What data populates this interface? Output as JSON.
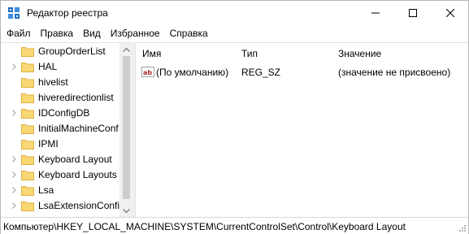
{
  "window": {
    "title": "Редактор реестра",
    "icon": "regedit-icon",
    "controls": [
      "minimize-icon",
      "maximize-icon",
      "close-icon"
    ]
  },
  "menu": [
    "Файл",
    "Правка",
    "Вид",
    "Избранное",
    "Справка"
  ],
  "tree": {
    "items": [
      {
        "label": "GroupOrderList",
        "expandable": false
      },
      {
        "label": "HAL",
        "expandable": true
      },
      {
        "label": "hivelist",
        "expandable": false
      },
      {
        "label": "hiveredirectionlist",
        "expandable": false
      },
      {
        "label": "IDConfigDB",
        "expandable": true
      },
      {
        "label": "InitialMachineConf",
        "expandable": false
      },
      {
        "label": "IPMI",
        "expandable": false
      },
      {
        "label": "Keyboard Layout",
        "expandable": true
      },
      {
        "label": "Keyboard Layouts",
        "expandable": true
      },
      {
        "label": "Lsa",
        "expandable": true
      },
      {
        "label": "LsaExtensionConfi",
        "expandable": true
      }
    ]
  },
  "list": {
    "columns": {
      "name": "Имя",
      "type": "Тип",
      "value": "Значение"
    },
    "rows": [
      {
        "icon": "string-value-icon",
        "name": "(По умолчанию)",
        "type": "REG_SZ",
        "value": "(значение не присвоено)"
      }
    ]
  },
  "status": {
    "path": "Компьютер\\HKEY_LOCAL_MACHINE\\SYSTEM\\CurrentControlSet\\Control\\Keyboard Layout"
  },
  "colors": {
    "folder": "#f8d775",
    "folder_dark": "#e0b23e",
    "icon_blue": "#1f6fc5",
    "scrollbar_thumb": "#cdcdcd"
  }
}
